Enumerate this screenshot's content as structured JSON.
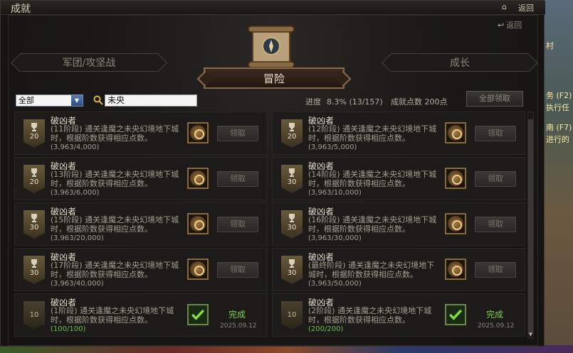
{
  "window": {
    "title": "成就",
    "home_label": "⌂",
    "back_label": "返回"
  },
  "panel": {
    "back_label": "返回"
  },
  "tabs": {
    "left": "军团/攻坚战",
    "active": "冒险",
    "right": "成长"
  },
  "filter": {
    "selected": "全部",
    "search_value": "未央"
  },
  "stats": {
    "progress_label": "进度",
    "progress_value": "8.3% (13/157)",
    "points_label": "成就点数",
    "points_value": "200点"
  },
  "claim_all_label": "全部领取",
  "cards": [
    {
      "title": "破凶者",
      "desc": "(11阶段) 通关逢魔之未央幻境地下城时，根据阶数获得相应点数。",
      "progress": "(3,963/4,000)",
      "points": "20",
      "status": "claim",
      "action_label": "领取",
      "date": ""
    },
    {
      "title": "破凶者",
      "desc": "(12阶段) 通关逢魔之未央幻境地下城时，根据阶数获得相应点数。",
      "progress": "(3,963/5,000)",
      "points": "20",
      "status": "claim",
      "action_label": "领取",
      "date": ""
    },
    {
      "title": "破凶者",
      "desc": "(13阶段) 通关逢魔之未央幻境地下城时，根据阶数获得相应点数。",
      "progress": "(3,963/6,000)",
      "points": "20",
      "status": "claim",
      "action_label": "领取",
      "date": ""
    },
    {
      "title": "破凶者",
      "desc": "(14阶段) 通关逢魔之未央幻境地下城时，根据阶数获得相应点数。",
      "progress": "(3,963/10,000)",
      "points": "30",
      "status": "claim",
      "action_label": "领取",
      "date": ""
    },
    {
      "title": "破凶者",
      "desc": "(15阶段) 通关逢魔之未央幻境地下城时，根据阶数获得相应点数。",
      "progress": "(3,963/20,000)",
      "points": "30",
      "status": "claim",
      "action_label": "领取",
      "date": ""
    },
    {
      "title": "破凶者",
      "desc": "(16阶段) 通关逢魔之未央幻境地下城时，根据阶数获得相应点数。",
      "progress": "(3,963/30,000)",
      "points": "30",
      "status": "claim",
      "action_label": "领取",
      "date": ""
    },
    {
      "title": "破凶者",
      "desc": "(17阶段) 通关逢魔之未央幻境地下城时，根据阶数获得相应点数。",
      "progress": "(3,963/40,000)",
      "points": "30",
      "status": "claim",
      "action_label": "领取",
      "date": ""
    },
    {
      "title": "破凶者",
      "desc": "(最终阶段) 通关逢魔之未央幻境地下城时，根据阶数获得相应点数。",
      "progress": "(3,963/50,000)",
      "points": "30",
      "status": "claim",
      "action_label": "领取",
      "date": ""
    },
    {
      "title": "破凶者",
      "desc": "(1阶段) 通关逢魔之未央幻境地下城时，根据阶数获得相应点数。",
      "progress": "(100/100)",
      "points": "10",
      "status": "done",
      "action_label": "完成",
      "date": "2025.09.12"
    },
    {
      "title": "破凶者",
      "desc": "(2阶段) 通关逢魔之未央幻境地下城时，根据阶数获得相应点数。",
      "progress": "(200/200)",
      "points": "10",
      "status": "done",
      "action_label": "完成",
      "date": "2025.09.12"
    }
  ],
  "background_text": [
    "务 (F2)",
    "执行任",
    "南 (F7)",
    "进行的",
    "村"
  ],
  "colors": {
    "done_green": "#7fcf4a",
    "accent_gold": "#8a6a4a"
  }
}
